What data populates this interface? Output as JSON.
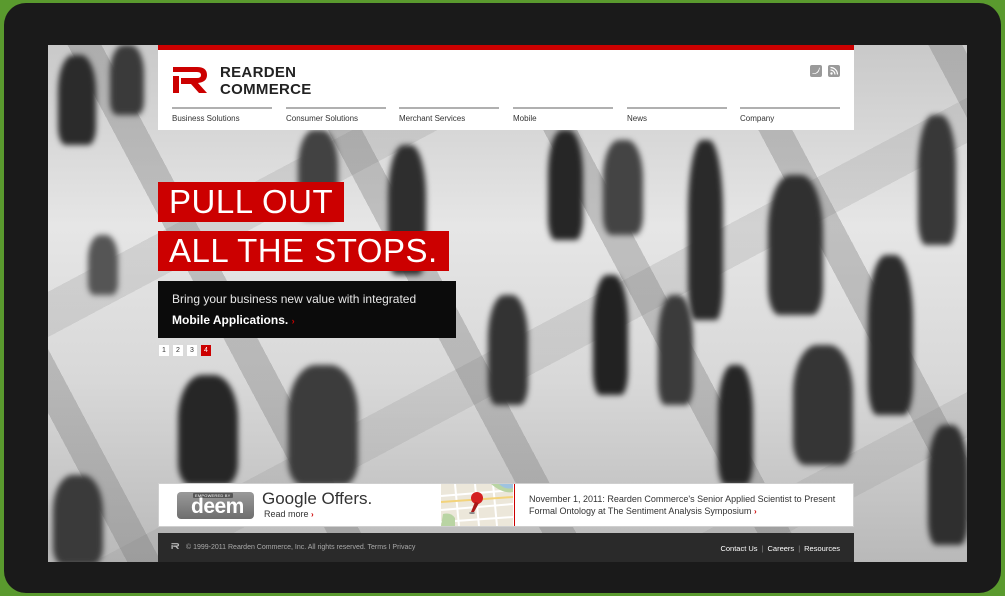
{
  "brand": {
    "name_line1": "REARDEN",
    "name_line2": "COMMERCE",
    "accent_color": "#cc0000"
  },
  "header": {
    "social_icons": [
      "twitter-icon",
      "rss-icon"
    ],
    "nav": [
      {
        "label": "Business Solutions"
      },
      {
        "label": "Consumer Solutions"
      },
      {
        "label": "Merchant Services"
      },
      {
        "label": "Mobile"
      },
      {
        "label": "News"
      },
      {
        "label": "Company"
      }
    ]
  },
  "hero": {
    "headline_line1": "PULL OUT",
    "headline_line2": "ALL THE STOPS.",
    "promo_text": "Bring your business new value with integrated",
    "promo_link": "Mobile Applications.",
    "arrow": "›"
  },
  "pager": {
    "pages": [
      "1",
      "2",
      "3",
      "4"
    ],
    "active": 4
  },
  "promo_panel": {
    "deem_small": "EMPOWERED BY",
    "deem_word": "deem",
    "title": "Google Offers.",
    "read_more": "Read more",
    "arrow": "›",
    "news_text": "November 1, 2011: Rearden Commerce's Senior Applied Scientist to Present Formal Ontology at The Sentiment Analysis Symposium"
  },
  "footer": {
    "copyright": "© 1999-2011 Rearden Commerce, Inc. All rights reserved. Terms I Privacy",
    "links": [
      "Contact Us",
      "Careers",
      "Resources"
    ],
    "separator": "|"
  }
}
